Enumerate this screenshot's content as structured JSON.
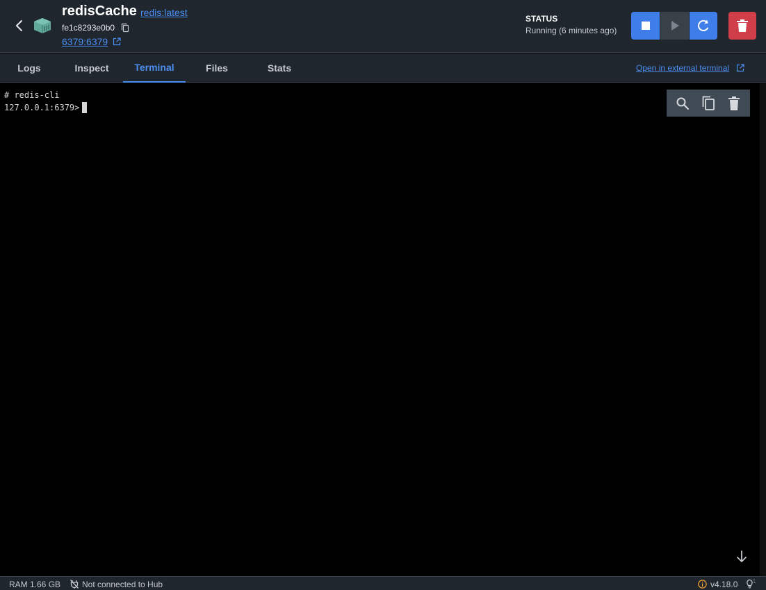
{
  "header": {
    "name": "redisCache",
    "image": "redis:latest",
    "container_id": "fe1c8293e0b0",
    "port": "6379:6379",
    "status_label": "STATUS",
    "status_text": "Running (6 minutes ago)"
  },
  "tabs": [
    {
      "label": "Logs"
    },
    {
      "label": "Inspect"
    },
    {
      "label": "Terminal"
    },
    {
      "label": "Files"
    },
    {
      "label": "Stats"
    }
  ],
  "active_tab": "Terminal",
  "external_terminal_label": "Open in external terminal",
  "terminal": {
    "lines": [
      "# redis-cli",
      "127.0.0.1:6379> "
    ]
  },
  "footer": {
    "ram": "RAM 1.66 GB",
    "hub": "Not connected to Hub",
    "version": "v4.18.0"
  },
  "colors": {
    "accent": "#4c8ff2",
    "danger": "#d03f49",
    "panel": "#1f262e",
    "container_icon": "#5fa89a"
  }
}
